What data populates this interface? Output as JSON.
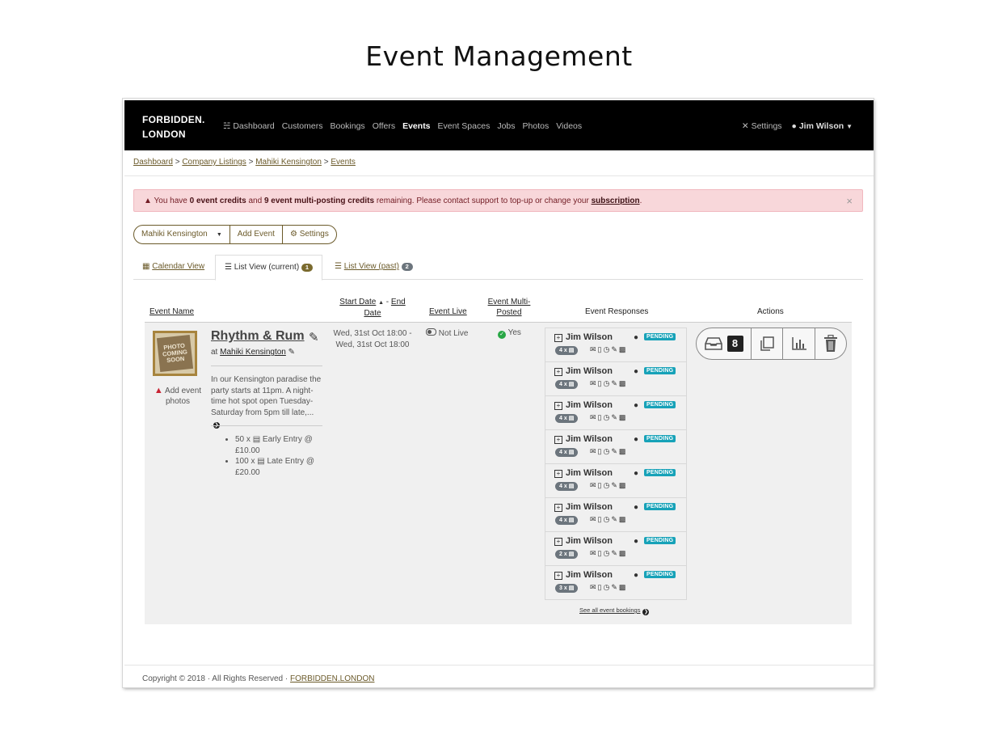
{
  "page": {
    "title": "Event Management"
  },
  "nav": {
    "brand_line1": "FORBIDDEN.",
    "brand_line2": "LONDON",
    "links": [
      "Dashboard",
      "Customers",
      "Bookings",
      "Offers",
      "Events",
      "Event Spaces",
      "Jobs",
      "Photos",
      "Videos"
    ],
    "active": "Events",
    "settings": "Settings",
    "user": "Jim Wilson"
  },
  "breadcrumb": {
    "items": [
      "Dashboard",
      "Company Listings",
      "Mahiki Kensington",
      "Events"
    ],
    "sep": ">"
  },
  "alert": {
    "p1": "You have ",
    "b1": "0 event credits",
    "p2": " and ",
    "b2": "9 event multi-posting credits",
    "p3": " remaining. Please contact support to top-up or change your ",
    "link": "subscription",
    "p4": ".",
    "close": "×"
  },
  "toolbar": {
    "venue": "Mahiki Kensington",
    "add": "Add Event",
    "settings": "Settings"
  },
  "tabs": {
    "calendar": "Calendar View",
    "current": "List View (current)",
    "current_count": "1",
    "past": "List View (past)",
    "past_count": "2"
  },
  "table": {
    "headers": {
      "name": "Event Name",
      "start": "Start Date",
      "dash": " - ",
      "end": "End",
      "date": "Date",
      "live": "Event Live",
      "multi1": "Event Multi-",
      "multi2": "Posted",
      "responses": "Event Responses",
      "actions": "Actions"
    }
  },
  "event": {
    "photo_text": "PHOTO COMING SOON",
    "add_photos": "Add event photos",
    "name": "Rhythm & Rum",
    "at": "at ",
    "venue": "Mahiki Kensington",
    "description": "In our Kensington paradise the party starts at 11pm. A night-time hot spot open Tuesday-Saturday from 5pm till late,...",
    "tickets": [
      {
        "qty": "50 x",
        "label": "Early Entry @ £10.00"
      },
      {
        "qty": "100 x",
        "label": "Late Entry @ £20.00"
      }
    ],
    "start_date": "Wed, 31st Oct 18:00 -",
    "end_date": "Wed, 31st Oct 18:00",
    "live_status": "Not Live",
    "multi_status": "Yes",
    "responses": [
      {
        "name": "Jim Wilson",
        "qty": "4 x",
        "status": "PENDING"
      },
      {
        "name": "Jim Wilson",
        "qty": "4 x",
        "status": "PENDING"
      },
      {
        "name": "Jim Wilson",
        "qty": "4 x",
        "status": "PENDING"
      },
      {
        "name": "Jim Wilson",
        "qty": "4 x",
        "status": "PENDING"
      },
      {
        "name": "Jim Wilson",
        "qty": "4 x",
        "status": "PENDING"
      },
      {
        "name": "Jim Wilson",
        "qty": "4 x",
        "status": "PENDING"
      },
      {
        "name": "Jim Wilson",
        "qty": "2 x",
        "status": "PENDING"
      },
      {
        "name": "Jim Wilson",
        "qty": "3 x",
        "status": "PENDING"
      }
    ],
    "see_all": "See all event bookings",
    "inbox_count": "8"
  },
  "footer": {
    "text": "Copyright © 2018 · All Rights Reserved · ",
    "link": "FORBIDDEN.LONDON"
  },
  "colors": {
    "accent": "#6b5a2a",
    "pending": "#17a2b8",
    "alert_bg": "#f8d7da",
    "nav_bg": "#000000"
  }
}
